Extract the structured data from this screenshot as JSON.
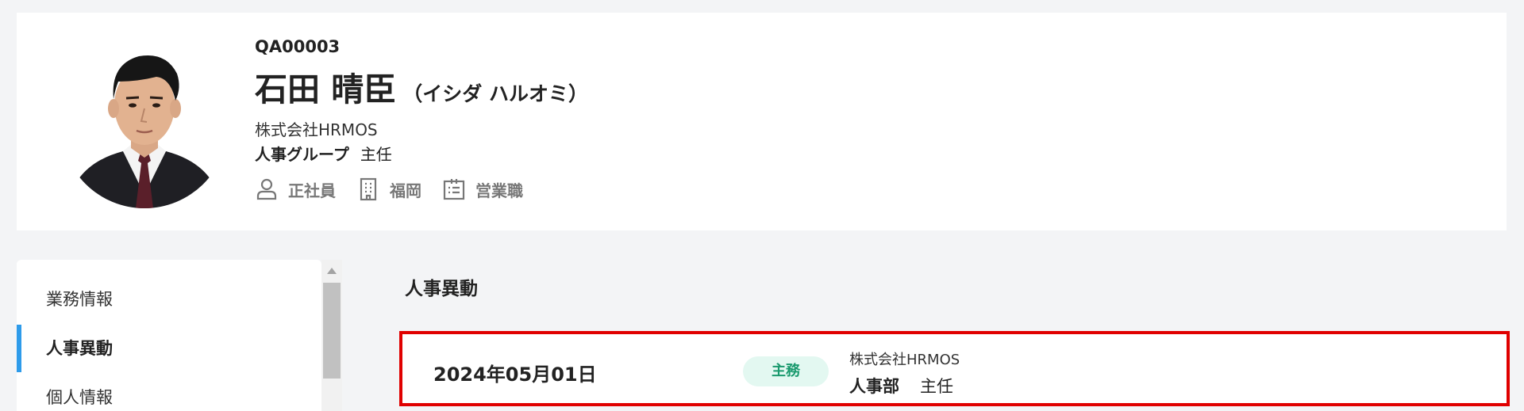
{
  "profile": {
    "employee_code": "QA00003",
    "name": "石田 晴臣",
    "name_kana": "（イシダ ハルオミ）",
    "company": "株式会社HRMOS",
    "department": "人事グループ",
    "position": "主任",
    "meta": {
      "employment_type": "正社員",
      "location": "福岡",
      "job_type": "営業職"
    },
    "icons": [
      "person-icon",
      "building-icon",
      "id-card-icon"
    ]
  },
  "sidebar": {
    "items": [
      {
        "label": "業務情報",
        "active": false
      },
      {
        "label": "人事異動",
        "active": true
      },
      {
        "label": "個人情報",
        "active": false
      }
    ]
  },
  "main": {
    "section_title": "人事異動",
    "transfers": [
      {
        "date": "2024年05月01日",
        "badge": "主務",
        "company": "株式会社HRMOS",
        "department": "人事部",
        "position": "主任"
      }
    ]
  },
  "colors": {
    "accent": "#2e9bea",
    "badge_bg": "#e3f8f1",
    "badge_text": "#1a9a6e",
    "highlight_border": "#e00000",
    "page_bg": "#f3f4f6"
  }
}
